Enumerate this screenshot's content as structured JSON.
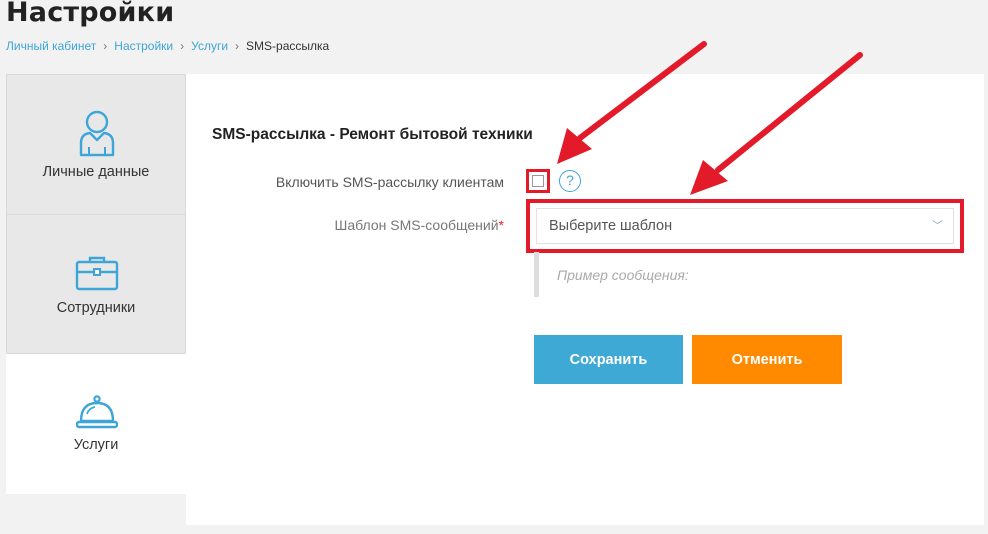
{
  "page": {
    "title": "Настройки"
  },
  "breadcrumb": {
    "items": [
      "Личный кабинет",
      "Настройки",
      "Услуги"
    ],
    "current": "SMS-рассылка"
  },
  "sidebar": {
    "items": [
      {
        "label": "Личные данные",
        "icon": "user-icon",
        "active": false
      },
      {
        "label": "Сотрудники",
        "icon": "briefcase-icon",
        "active": false
      },
      {
        "label": "Услуги",
        "icon": "service-bell-icon",
        "active": true
      }
    ]
  },
  "form": {
    "section_title": "SMS-рассылка - Ремонт бытовой техники",
    "enable_label": "Включить SMS-рассылку клиентам",
    "enable_checked": false,
    "help_glyph": "?",
    "template_label": "Шаблон SMS-сообщений",
    "required_mark": "*",
    "template_placeholder": "Выберите шаблон",
    "example_text": "Пример сообщения:",
    "save_label": "Сохранить",
    "cancel_label": "Отменить"
  },
  "colors": {
    "accent": "#3ea9d5",
    "cancel": "#ff8a00",
    "annotation": "#e21a2a"
  }
}
